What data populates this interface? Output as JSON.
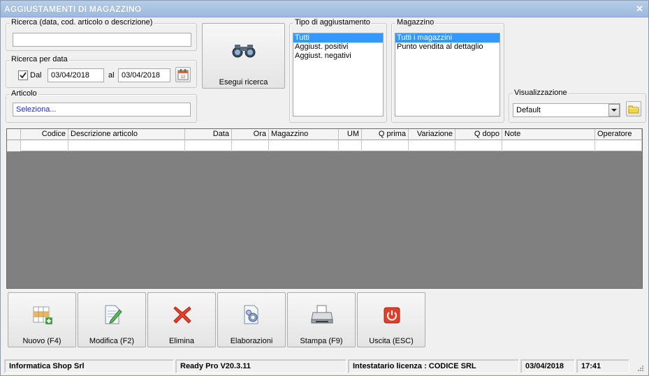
{
  "window": {
    "title": "AGGIUSTAMENTI DI MAGAZZINO",
    "close_glyph": "✕"
  },
  "search": {
    "label": "Ricerca (data, cod. articolo o descrizione)",
    "value": ""
  },
  "date_search": {
    "label": "Ricerca per data",
    "checkbox_label": "Dal",
    "checked": true,
    "from": "03/04/2018",
    "to_label": "al",
    "to": "03/04/2018"
  },
  "article": {
    "label": "Articolo",
    "value": "Seleziona..."
  },
  "search_button": {
    "label": "Esegui ricerca",
    "icon": "binoculars-icon"
  },
  "adjustment_type": {
    "label": "Tipo di aggiustamento",
    "options": [
      "Tutti",
      "Aggiust. positivi",
      "Aggiust. negativi"
    ],
    "selected": 0
  },
  "warehouse": {
    "label": "Magazzino",
    "options": [
      "Tutti i magazzini",
      "Punto vendita al dettaglio"
    ],
    "selected": 0
  },
  "view": {
    "label": "Visualizzazione",
    "value": "Default"
  },
  "grid": {
    "columns": [
      "Codice",
      "Descrizione articolo",
      "Data",
      "Ora",
      "Magazzino",
      "UM",
      "Q prima",
      "Variazione",
      "Q dopo",
      "Note",
      "Operatore"
    ],
    "rows": [
      [
        "",
        "",
        "",
        "",
        "",
        "",
        "",
        "",
        "",
        "",
        ""
      ]
    ]
  },
  "toolbar": {
    "new_label": "Nuovo (F4)",
    "edit_label": "Modifica (F2)",
    "delete_label": "Elimina",
    "process_label": "Elaborazioni",
    "print_label": "Stampa (F9)",
    "exit_label": "Uscita (ESC)"
  },
  "status": {
    "company": "Informatica Shop Srl",
    "version": "Ready Pro V20.3.11",
    "license": "Intestatario licenza : CODICE SRL",
    "date": "03/04/2018",
    "time": "17:41"
  },
  "colors": {
    "selection": "#3399ff",
    "titlebar": "#a9c4e6",
    "grid_bg": "#808080",
    "link_text": "#1a2bd6"
  }
}
